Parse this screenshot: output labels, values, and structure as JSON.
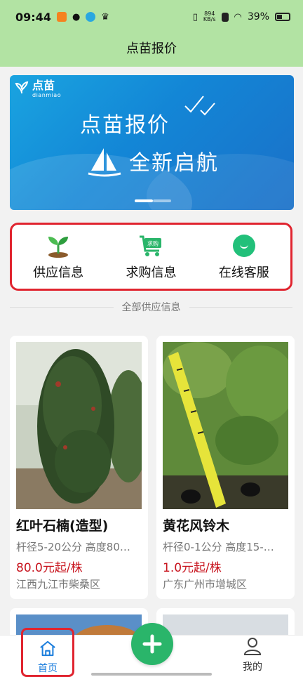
{
  "status_bar": {
    "time": "09:44",
    "net_speed": "894",
    "net_unit": "KB/s",
    "battery": "39%"
  },
  "header": {
    "title": "点苗报价"
  },
  "banner": {
    "brand": "点苗",
    "brand_sub": "dianmiao",
    "line1": "点苗报价",
    "line2": "全新启航"
  },
  "quick_actions": [
    {
      "label": "供应信息",
      "icon": "seedling-icon"
    },
    {
      "label": "求购信息",
      "icon": "cart-icon",
      "badge": "求购"
    },
    {
      "label": "在线客服",
      "icon": "chat-icon"
    }
  ],
  "section": {
    "title": "全部供应信息"
  },
  "products": [
    {
      "name": "红叶石楠(造型)",
      "spec": "杆径5-20公分 高度80…",
      "price": "80.0元起/株",
      "location": "江西九江市柴桑区"
    },
    {
      "name": "黄花风铃木",
      "spec": "杆径0-1公分 高度15-…",
      "price": "1.0元起/株",
      "location": "广东广州市增城区"
    }
  ],
  "bottom_nav": {
    "home": "首页",
    "me": "我的"
  },
  "colors": {
    "header_green": "#b2e3a3",
    "accent_green": "#2ab56a",
    "price_red": "#c8141e",
    "active_blue": "#1c7edc",
    "highlight_red": "#e0242f"
  }
}
